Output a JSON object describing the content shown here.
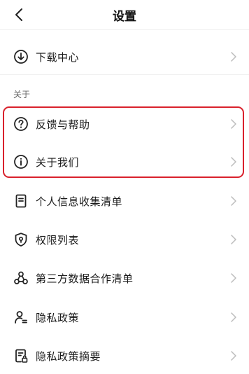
{
  "header": {
    "title": "设置",
    "back_icon": "back-arrow-icon"
  },
  "download": {
    "label": "下载中心",
    "icon": "download-circle-icon"
  },
  "about_section": {
    "title": "关于",
    "items": [
      {
        "label": "反馈与帮助",
        "icon": "help-circle-icon"
      },
      {
        "label": "关于我们",
        "icon": "info-circle-icon"
      }
    ]
  },
  "privacy_items": [
    {
      "label": "个人信息收集清单",
      "icon": "document-list-icon"
    },
    {
      "label": "权限列表",
      "icon": "shield-lock-icon"
    },
    {
      "label": "第三方数据合作清单",
      "icon": "share-nodes-icon"
    },
    {
      "label": "隐私政策",
      "icon": "user-privacy-icon"
    },
    {
      "label": "隐私政策摘要",
      "icon": "document-lock-icon"
    }
  ],
  "colors": {
    "highlight": "#d9212c",
    "chevron": "#bdbdbd",
    "divider": "#f0f0f0"
  }
}
